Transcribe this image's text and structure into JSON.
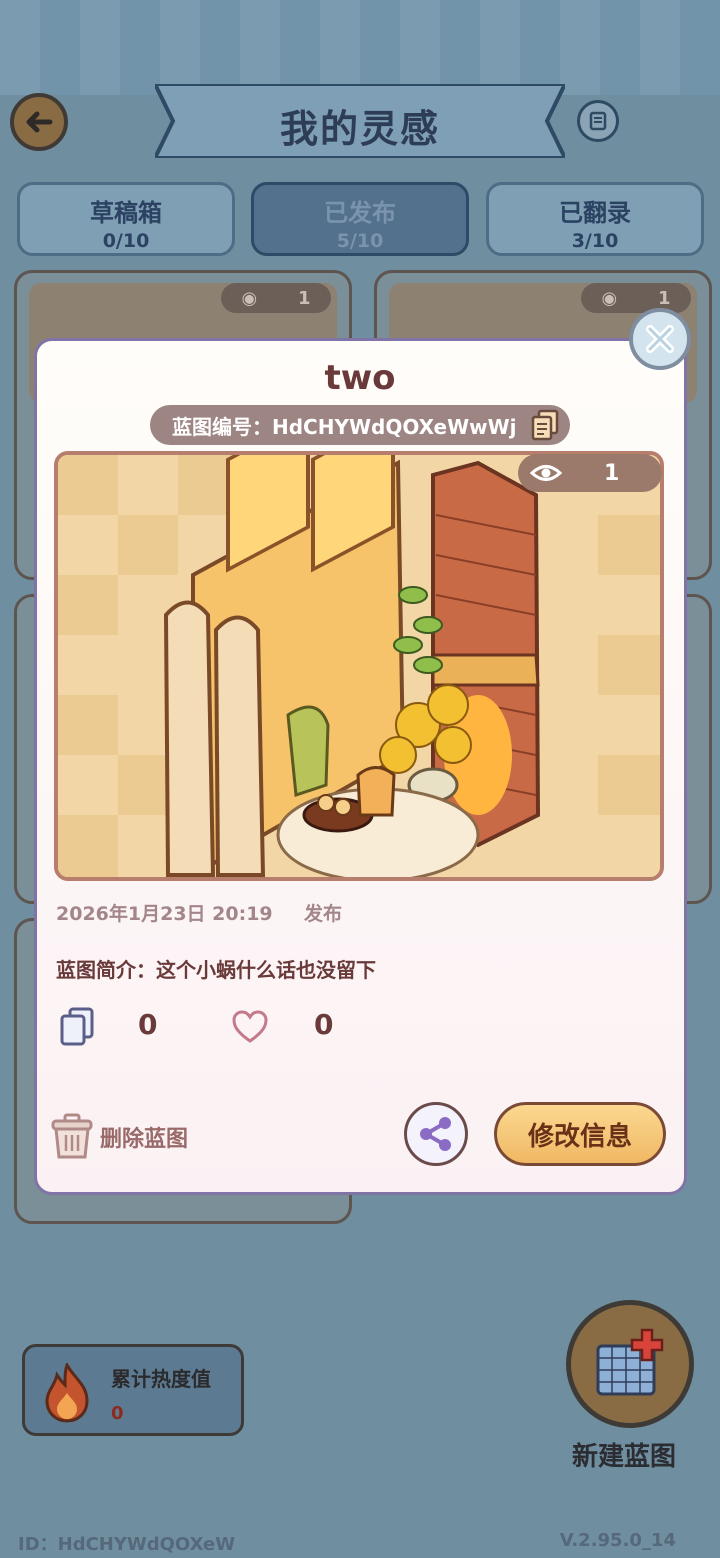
{
  "header": {
    "title": "我的灵感",
    "back_icon": "back-arrow-icon",
    "guide_icon": "scroll-icon"
  },
  "tabs": [
    {
      "label": "草稿箱",
      "count": "0/10",
      "active": false
    },
    {
      "label": "已发布",
      "count": "5/10",
      "active": true
    },
    {
      "label": "已翻录",
      "count": "3/10",
      "active": false
    }
  ],
  "background_cards": [
    {
      "views": "1"
    },
    {
      "views": "1"
    }
  ],
  "heat": {
    "label": "累计热度值",
    "value": "0"
  },
  "new_blueprint": {
    "label": "新建蓝图"
  },
  "footer": {
    "id": "ID：HdCHYWdQOXeW",
    "version": "V.2.95.0_14"
  },
  "modal": {
    "title": "two",
    "code_label": "蓝图编号：HdCHYWdQOXeWwWj",
    "views": "1",
    "publish_date": "2026年1月23日 20:19",
    "publish_word": "发布",
    "intro": "蓝图简介：这个小蜗什么话也没留下",
    "copy_count": "0",
    "like_count": "0",
    "delete_label": "删除蓝图",
    "edit_label": "修改信息"
  },
  "colors": {
    "title_brown": "#6a3a3a",
    "modal_border": "#8073a6",
    "edit_button": "#f0b864",
    "overlay_blue": "#6f8e9f"
  }
}
